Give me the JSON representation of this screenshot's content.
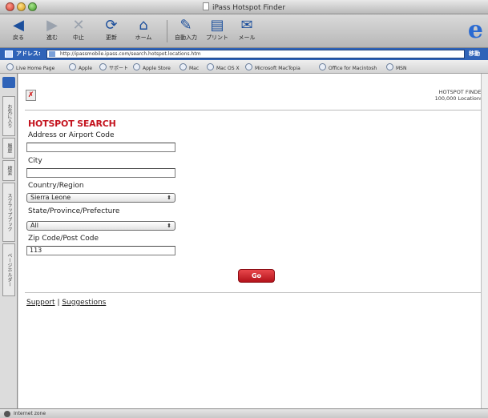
{
  "window": {
    "title": "iPass Hotspot Finder"
  },
  "toolbar": {
    "buttons": [
      {
        "icon": "back-arrow-icon",
        "label": "戻る"
      },
      {
        "icon": "forward-arrow-icon",
        "label": "進む"
      },
      {
        "icon": "stop-icon",
        "label": "中止"
      },
      {
        "icon": "refresh-icon",
        "label": "更新"
      },
      {
        "icon": "home-icon",
        "label": "ホーム"
      },
      {
        "icon": "autofill-icon",
        "label": "自動入力"
      },
      {
        "icon": "print-icon",
        "label": "プリント"
      },
      {
        "icon": "mail-icon",
        "label": "メール"
      }
    ]
  },
  "address_bar": {
    "label": "アドレス:",
    "url": "http://ipassmobile.ipass.com/search.hotspot.locations.htm",
    "go_label": "移動"
  },
  "favorites": [
    "Live Home Page",
    "Apple",
    "サポート",
    "Apple Store",
    "Mac",
    "Mac OS X",
    "Microsoft MacTopia",
    "Office for Macintosh",
    "MSN"
  ],
  "explorer_tabs": [
    "お気に入り",
    "履歴",
    "検索",
    "スクラップブック",
    "ページホルダー"
  ],
  "page": {
    "brand": {
      "line1": "HOTSPOT FINDER",
      "line2": "100,000 Locations!"
    },
    "section_title": "HOTSPOT SEARCH",
    "fields": {
      "address": {
        "label": "Address or Airport Code",
        "value": ""
      },
      "city": {
        "label": "City",
        "value": ""
      },
      "country": {
        "label": "Country/Region",
        "value": "Sierra Leone"
      },
      "state": {
        "label": "State/Province/Prefecture",
        "value": "All"
      },
      "zip": {
        "label": "Zip Code/Post Code",
        "value": "113"
      }
    },
    "go_button": "Go",
    "footer": {
      "support": "Support",
      "separator": " | ",
      "suggestions": "Suggestions"
    }
  },
  "status_bar": {
    "text": "Internet zone"
  }
}
